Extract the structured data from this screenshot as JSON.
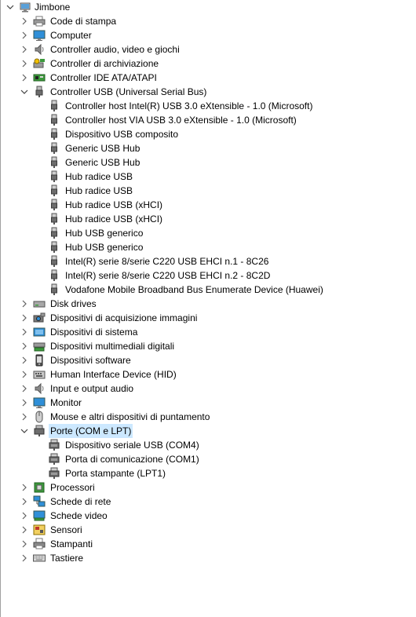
{
  "root": {
    "label": "Jimbone",
    "icon": "computer-icon",
    "expanded": true
  },
  "categories": [
    {
      "label": "Code di stampa",
      "icon": "print-queue-icon",
      "expanded": false
    },
    {
      "label": "Computer",
      "icon": "monitor-icon",
      "expanded": false
    },
    {
      "label": "Controller audio, video e giochi",
      "icon": "speaker-icon",
      "expanded": false
    },
    {
      "label": "Controller di archiviazione",
      "icon": "storage-controller-icon",
      "expanded": false
    },
    {
      "label": "Controller IDE ATA/ATAPI",
      "icon": "ide-controller-icon",
      "expanded": false
    },
    {
      "label": "Controller USB (Universal Serial Bus)",
      "icon": "usb-icon",
      "expanded": true,
      "children": [
        "Controller host Intel(R) USB 3.0 eXtensible - 1.0 (Microsoft)",
        "Controller host VIA USB 3.0 eXtensible - 1.0 (Microsoft)",
        "Dispositivo USB composito",
        "Generic USB Hub",
        "Generic USB Hub",
        "Hub radice USB",
        "Hub radice USB",
        "Hub radice USB (xHCI)",
        "Hub radice USB (xHCI)",
        "Hub USB generico",
        "Hub USB generico",
        "Intel(R) serie 8/serie C220 USB EHCI n.1 - 8C26",
        "Intel(R) serie 8/serie C220 USB EHCI n.2 - 8C2D",
        "Vodafone Mobile Broadband Bus Enumerate Device (Huawei)"
      ]
    },
    {
      "label": "Disk drives",
      "icon": "disk-drive-icon",
      "expanded": false
    },
    {
      "label": "Dispositivi di acquisizione immagini",
      "icon": "camera-icon",
      "expanded": false
    },
    {
      "label": "Dispositivi di sistema",
      "icon": "system-device-icon",
      "expanded": false
    },
    {
      "label": "Dispositivi multimediali digitali",
      "icon": "multimedia-device-icon",
      "expanded": false
    },
    {
      "label": "Dispositivi software",
      "icon": "software-device-icon",
      "expanded": false
    },
    {
      "label": "Human Interface Device (HID)",
      "icon": "hid-icon",
      "expanded": false
    },
    {
      "label": "Input e output audio",
      "icon": "speaker-icon",
      "expanded": false
    },
    {
      "label": "Monitor",
      "icon": "monitor-icon",
      "expanded": false
    },
    {
      "label": "Mouse e altri dispositivi di puntamento",
      "icon": "mouse-icon",
      "expanded": false
    },
    {
      "label": "Porte (COM e LPT)",
      "icon": "port-icon",
      "expanded": true,
      "selected": true,
      "children": [
        "Dispositivo seriale USB (COM4)",
        "Porta di comunicazione (COM1)",
        "Porta stampante (LPT1)"
      ]
    },
    {
      "label": "Processori",
      "icon": "processor-icon",
      "expanded": false
    },
    {
      "label": "Schede di rete",
      "icon": "network-adapter-icon",
      "expanded": false
    },
    {
      "label": "Schede video",
      "icon": "display-adapter-icon",
      "expanded": false
    },
    {
      "label": "Sensori",
      "icon": "sensor-icon",
      "expanded": false
    },
    {
      "label": "Stampanti",
      "icon": "printer-icon",
      "expanded": false
    },
    {
      "label": "Tastiere",
      "icon": "keyboard-icon",
      "expanded": false
    }
  ],
  "colors": {
    "selection": "#cce8ff",
    "chevron": "#606060",
    "icon_gray": "#6d6d6d",
    "icon_blue": "#2f8fd8",
    "border": "#a0a0a0"
  }
}
